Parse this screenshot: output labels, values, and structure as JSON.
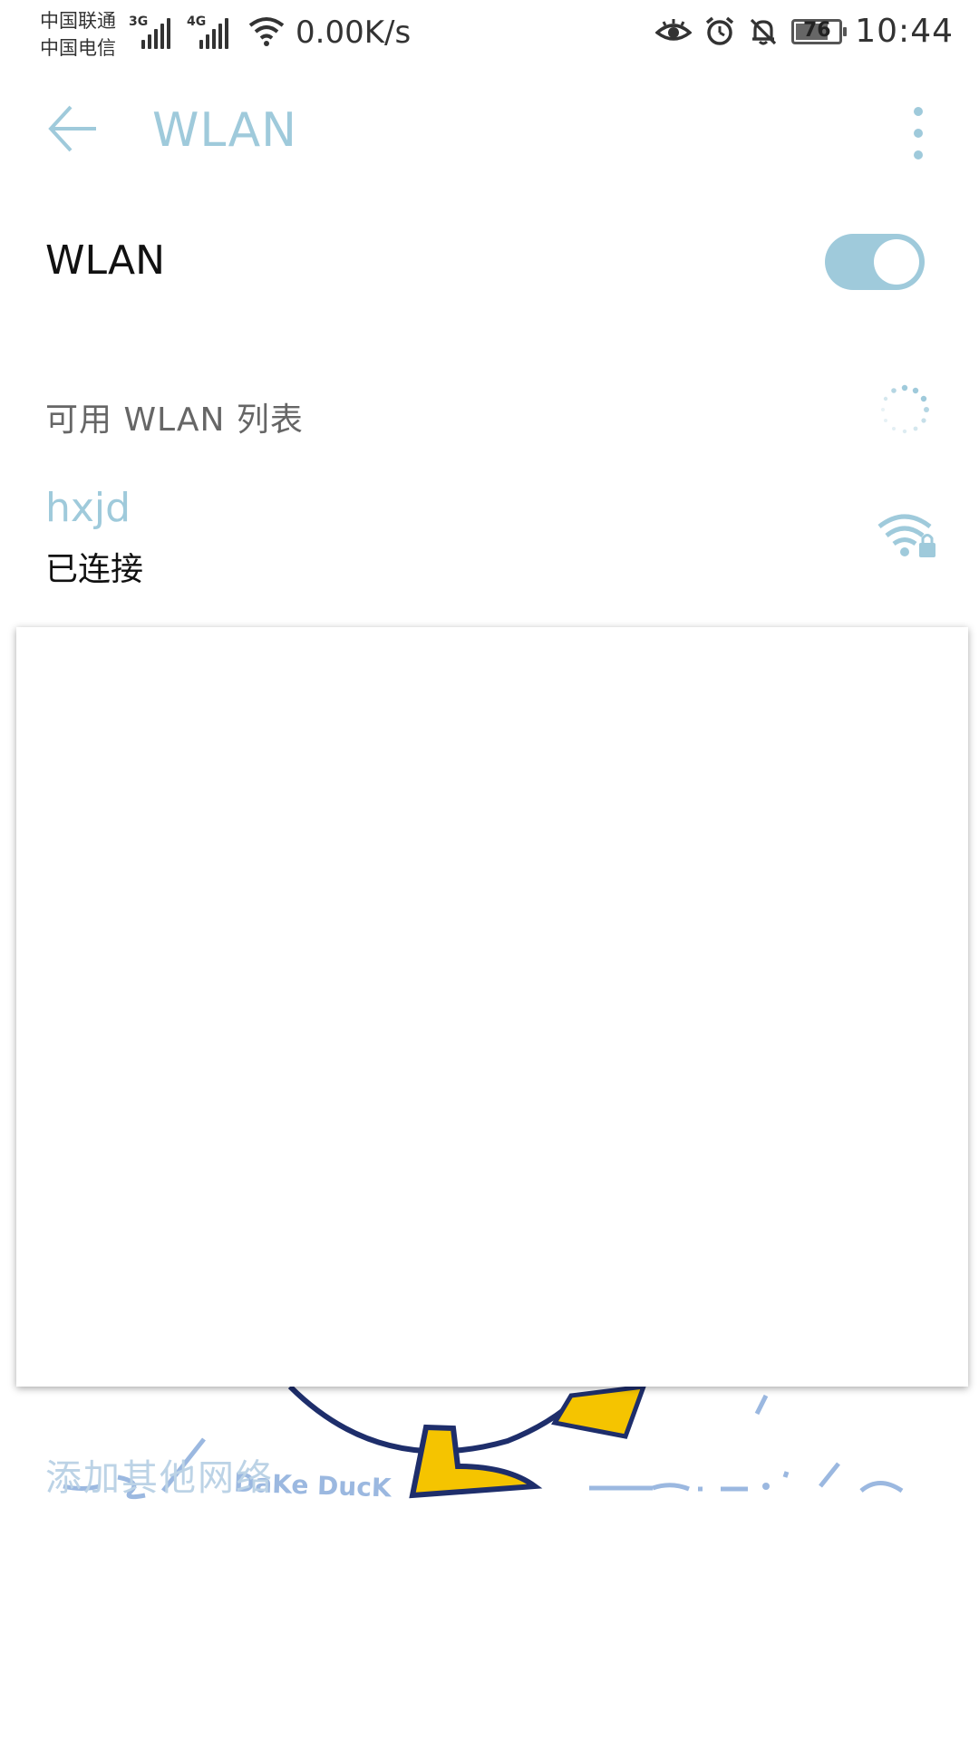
{
  "status_bar": {
    "carrier_1": "中国联通",
    "carrier_2": "中国电信",
    "net_type_1": "3G",
    "net_type_2": "4G",
    "speed": "0.00K/s",
    "battery": "76",
    "time": "10:44",
    "icons": [
      "eye-icon",
      "alarm-icon",
      "bell-off-icon",
      "battery-icon"
    ]
  },
  "app_bar": {
    "title": "WLAN"
  },
  "wlan_toggle": {
    "label": "WLAN",
    "state": "on"
  },
  "section": {
    "label": "可用 WLAN 列表"
  },
  "networks": [
    {
      "ssid": "hxjd",
      "status": "已连接",
      "icon": "wifi-lock-icon"
    }
  ],
  "add_network": {
    "label": "添加其他网络"
  },
  "wallpaper": {
    "text": "DaKe DucK"
  },
  "colors": {
    "accent": "#9fcadb",
    "dark_blue": "#1e2e6b",
    "duck_yellow": "#f5c400",
    "doodle_blue": "#9bb8e0"
  }
}
